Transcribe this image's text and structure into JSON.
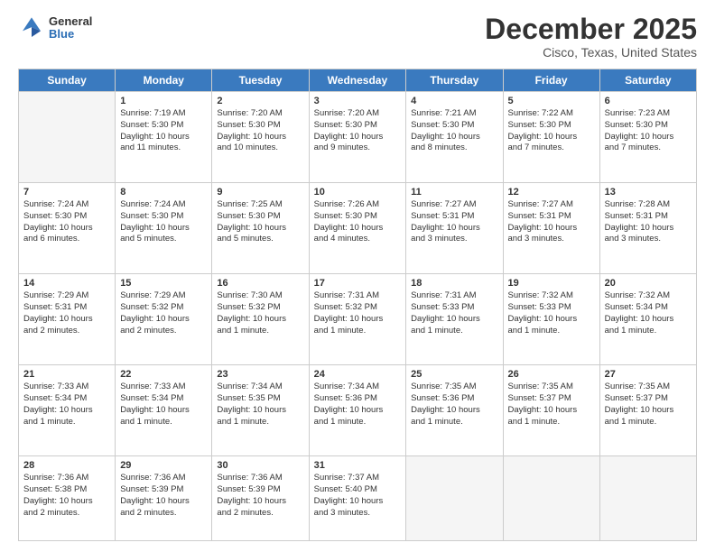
{
  "logo": {
    "general": "General",
    "blue": "Blue"
  },
  "header": {
    "month_year": "December 2025",
    "location": "Cisco, Texas, United States"
  },
  "calendar": {
    "days_of_week": [
      "Sunday",
      "Monday",
      "Tuesday",
      "Wednesday",
      "Thursday",
      "Friday",
      "Saturday"
    ],
    "weeks": [
      [
        {
          "day": "",
          "info": ""
        },
        {
          "day": "1",
          "info": "Sunrise: 7:19 AM\nSunset: 5:30 PM\nDaylight: 10 hours\nand 11 minutes."
        },
        {
          "day": "2",
          "info": "Sunrise: 7:20 AM\nSunset: 5:30 PM\nDaylight: 10 hours\nand 10 minutes."
        },
        {
          "day": "3",
          "info": "Sunrise: 7:20 AM\nSunset: 5:30 PM\nDaylight: 10 hours\nand 9 minutes."
        },
        {
          "day": "4",
          "info": "Sunrise: 7:21 AM\nSunset: 5:30 PM\nDaylight: 10 hours\nand 8 minutes."
        },
        {
          "day": "5",
          "info": "Sunrise: 7:22 AM\nSunset: 5:30 PM\nDaylight: 10 hours\nand 7 minutes."
        },
        {
          "day": "6",
          "info": "Sunrise: 7:23 AM\nSunset: 5:30 PM\nDaylight: 10 hours\nand 7 minutes."
        }
      ],
      [
        {
          "day": "7",
          "info": "Sunrise: 7:24 AM\nSunset: 5:30 PM\nDaylight: 10 hours\nand 6 minutes."
        },
        {
          "day": "8",
          "info": "Sunrise: 7:24 AM\nSunset: 5:30 PM\nDaylight: 10 hours\nand 5 minutes."
        },
        {
          "day": "9",
          "info": "Sunrise: 7:25 AM\nSunset: 5:30 PM\nDaylight: 10 hours\nand 5 minutes."
        },
        {
          "day": "10",
          "info": "Sunrise: 7:26 AM\nSunset: 5:30 PM\nDaylight: 10 hours\nand 4 minutes."
        },
        {
          "day": "11",
          "info": "Sunrise: 7:27 AM\nSunset: 5:31 PM\nDaylight: 10 hours\nand 3 minutes."
        },
        {
          "day": "12",
          "info": "Sunrise: 7:27 AM\nSunset: 5:31 PM\nDaylight: 10 hours\nand 3 minutes."
        },
        {
          "day": "13",
          "info": "Sunrise: 7:28 AM\nSunset: 5:31 PM\nDaylight: 10 hours\nand 3 minutes."
        }
      ],
      [
        {
          "day": "14",
          "info": "Sunrise: 7:29 AM\nSunset: 5:31 PM\nDaylight: 10 hours\nand 2 minutes."
        },
        {
          "day": "15",
          "info": "Sunrise: 7:29 AM\nSunset: 5:32 PM\nDaylight: 10 hours\nand 2 minutes."
        },
        {
          "day": "16",
          "info": "Sunrise: 7:30 AM\nSunset: 5:32 PM\nDaylight: 10 hours\nand 1 minute."
        },
        {
          "day": "17",
          "info": "Sunrise: 7:31 AM\nSunset: 5:32 PM\nDaylight: 10 hours\nand 1 minute."
        },
        {
          "day": "18",
          "info": "Sunrise: 7:31 AM\nSunset: 5:33 PM\nDaylight: 10 hours\nand 1 minute."
        },
        {
          "day": "19",
          "info": "Sunrise: 7:32 AM\nSunset: 5:33 PM\nDaylight: 10 hours\nand 1 minute."
        },
        {
          "day": "20",
          "info": "Sunrise: 7:32 AM\nSunset: 5:34 PM\nDaylight: 10 hours\nand 1 minute."
        }
      ],
      [
        {
          "day": "21",
          "info": "Sunrise: 7:33 AM\nSunset: 5:34 PM\nDaylight: 10 hours\nand 1 minute."
        },
        {
          "day": "22",
          "info": "Sunrise: 7:33 AM\nSunset: 5:34 PM\nDaylight: 10 hours\nand 1 minute."
        },
        {
          "day": "23",
          "info": "Sunrise: 7:34 AM\nSunset: 5:35 PM\nDaylight: 10 hours\nand 1 minute."
        },
        {
          "day": "24",
          "info": "Sunrise: 7:34 AM\nSunset: 5:36 PM\nDaylight: 10 hours\nand 1 minute."
        },
        {
          "day": "25",
          "info": "Sunrise: 7:35 AM\nSunset: 5:36 PM\nDaylight: 10 hours\nand 1 minute."
        },
        {
          "day": "26",
          "info": "Sunrise: 7:35 AM\nSunset: 5:37 PM\nDaylight: 10 hours\nand 1 minute."
        },
        {
          "day": "27",
          "info": "Sunrise: 7:35 AM\nSunset: 5:37 PM\nDaylight: 10 hours\nand 1 minute."
        }
      ],
      [
        {
          "day": "28",
          "info": "Sunrise: 7:36 AM\nSunset: 5:38 PM\nDaylight: 10 hours\nand 2 minutes."
        },
        {
          "day": "29",
          "info": "Sunrise: 7:36 AM\nSunset: 5:39 PM\nDaylight: 10 hours\nand 2 minutes."
        },
        {
          "day": "30",
          "info": "Sunrise: 7:36 AM\nSunset: 5:39 PM\nDaylight: 10 hours\nand 2 minutes."
        },
        {
          "day": "31",
          "info": "Sunrise: 7:37 AM\nSunset: 5:40 PM\nDaylight: 10 hours\nand 3 minutes."
        },
        {
          "day": "",
          "info": ""
        },
        {
          "day": "",
          "info": ""
        },
        {
          "day": "",
          "info": ""
        }
      ]
    ]
  }
}
